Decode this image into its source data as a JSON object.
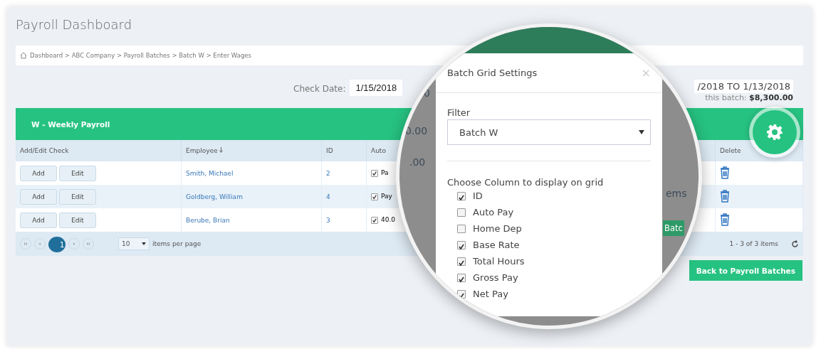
{
  "page_title": "Payroll Dashboard",
  "breadcrumb": "Dashboard > ABC Company > Payroll Batches > Batch W > Enter Wages",
  "check_date": {
    "label": "Check Date:",
    "value": "1/15/2018"
  },
  "period": {
    "range": "/2018 TO 1/13/2018",
    "total": "this batch: **$8,300.00**"
  },
  "grid": {
    "title": "W - Weekly Payroll",
    "columns": [
      "Add/Edit Check",
      "Employee",
      "ID",
      "Auto",
      "Delete"
    ],
    "rows": [
      {
        "add": "Add",
        "edit": "Edit",
        "employee": "Smith, Michael",
        "id": "2",
        "auto_checked": true,
        "auto_text": "Pa"
      },
      {
        "add": "Add",
        "edit": "Edit",
        "employee": "Goldberg, William",
        "id": "4",
        "auto_checked": true,
        "auto_text": "Pay"
      },
      {
        "add": "Add",
        "edit": "Edit",
        "employee": "Berube, Brian",
        "id": "3",
        "auto_checked": true,
        "auto_text": "40.0"
      }
    ],
    "pages": [
      {
        "label": "1",
        "selected": true
      }
    ],
    "page_size": "10",
    "per_page_label": "items per page",
    "range": "1 - 3 of 3 items"
  },
  "back_button": "Back to Payroll Batches",
  "magnifier_background": [
    {
      "kind": "text",
      "text": "0"
    },
    {
      "kind": "text",
      "text": "0.00"
    },
    {
      "kind": "text",
      "text": ".00"
    },
    {
      "kind": "text",
      "text": "ems"
    },
    {
      "kind": "button",
      "text": "Batc"
    }
  ],
  "settings_modal": {
    "title": "Batch Grid Settings",
    "close": "×",
    "filter_label": "Filter",
    "filter_value": "Batch W",
    "columns_label": "Choose Column to display on grid",
    "columns": [
      {
        "label": "ID",
        "checked": true
      },
      {
        "label": "Auto Pay",
        "checked": false
      },
      {
        "label": "Home Dep",
        "checked": false
      },
      {
        "label": "Base Rate",
        "checked": true
      },
      {
        "label": "Total Hours",
        "checked": true
      },
      {
        "label": "Gross Pay",
        "checked": true
      },
      {
        "label": "Net Pay",
        "checked": true
      }
    ]
  }
}
